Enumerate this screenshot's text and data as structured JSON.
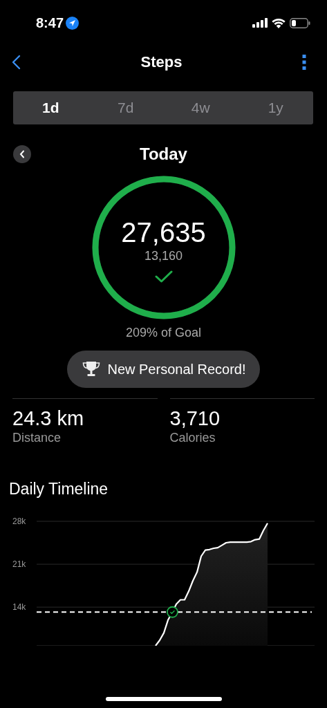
{
  "status_bar": {
    "time": "8:47"
  },
  "nav": {
    "title": "Steps"
  },
  "tabs": [
    {
      "label": "1d",
      "selected": true
    },
    {
      "label": "7d",
      "selected": false
    },
    {
      "label": "4w",
      "selected": false
    },
    {
      "label": "1y",
      "selected": false
    }
  ],
  "period": {
    "title": "Today"
  },
  "ring": {
    "steps": "27,635",
    "goal": "13,160",
    "goal_met": true,
    "level": 1,
    "caption": "209% of Goal"
  },
  "record_button": {
    "label": "New Personal Record!"
  },
  "stats": [
    {
      "value": "24.3 km",
      "label": "Distance"
    },
    {
      "value": "3,710",
      "label": "Calories"
    }
  ],
  "timeline": {
    "title": "Daily Timeline",
    "chart_data": {
      "type": "area",
      "grid": true,
      "ylim": [
        7700,
        28000
      ],
      "yticks": [
        {
          "value": 14000,
          "label": "14k"
        },
        {
          "value": 21000,
          "label": "21k"
        },
        {
          "value": 28000,
          "label": "28k"
        }
      ],
      "categories": [
        null,
        null,
        null,
        null,
        null,
        null,
        null,
        null,
        null,
        null,
        null,
        null,
        null,
        null,
        null,
        null,
        null,
        null,
        null,
        null,
        null,
        null,
        null,
        null,
        null,
        null,
        null,
        null,
        null,
        null,
        null,
        null,
        null,
        null,
        null,
        null,
        null,
        null,
        null,
        null,
        null,
        null,
        null,
        null,
        null,
        null,
        null,
        null,
        null,
        null,
        null,
        null,
        null,
        null,
        null,
        null,
        null,
        null,
        null,
        null,
        null,
        null,
        null,
        null,
        null,
        null,
        null,
        null
      ],
      "series": [
        {
          "color": "#ffffff",
          "values": [
            null,
            null,
            null,
            null,
            null,
            null,
            null,
            null,
            null,
            null,
            null,
            null,
            null,
            null,
            null,
            null,
            null,
            null,
            null,
            null,
            null,
            null,
            null,
            null,
            null,
            null,
            null,
            null,
            null,
            7700,
            8600,
            9800,
            11900,
            13100,
            14500,
            15200,
            15200,
            16600,
            18300,
            19700,
            22300,
            23300,
            23400,
            23600,
            23700,
            24100,
            24500,
            24600,
            24600,
            24600,
            24600,
            24600,
            24700,
            25000,
            25100,
            26500,
            27700,
            null,
            null,
            null,
            null,
            null,
            null,
            null,
            null,
            null,
            null,
            null
          ]
        }
      ],
      "ref_lines": [
        {
          "axis": "y",
          "value": 13200
        }
      ]
    }
  }
}
